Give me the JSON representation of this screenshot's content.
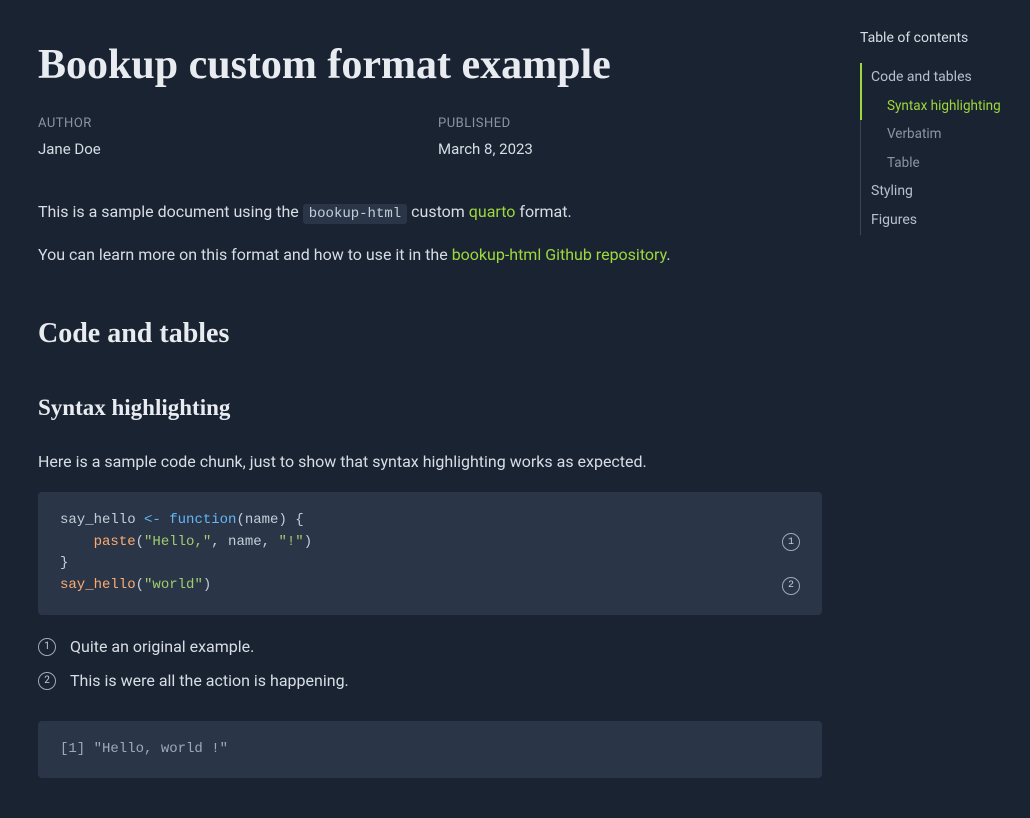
{
  "title": "Bookup custom format example",
  "meta": {
    "author_label": "AUTHOR",
    "author_value": "Jane Doe",
    "published_label": "PUBLISHED",
    "published_value": "March 8, 2023"
  },
  "intro": {
    "p1_pre": "This is a sample document using the ",
    "p1_code": "bookup-html",
    "p1_mid": " custom ",
    "p1_link": "quarto",
    "p1_post": " format.",
    "p2_pre": "You can learn more on this format and how to use it in the ",
    "p2_link": "bookup-html Github repository",
    "p2_post": "."
  },
  "sections": {
    "code_and_tables": "Code and tables",
    "syntax_highlighting": "Syntax highlighting",
    "syntax_intro": "Here is a sample code chunk, just to show that syntax highlighting works as expected."
  },
  "code": {
    "l1_name": "say_hello ",
    "l1_op": "<-",
    "l1_sp": " ",
    "l1_kw": "function",
    "l1_rest": "(name) {",
    "l2_indent": "    ",
    "l2_fn": "paste",
    "l2_p1": "(",
    "l2_s1": "\"Hello,\"",
    "l2_c1": ", name, ",
    "l2_s2": "\"!\"",
    "l2_p2": ")",
    "l3": "}",
    "l4": "",
    "l5_fn": "say_hello",
    "l5_p1": "(",
    "l5_s1": "\"world\"",
    "l5_p2": ")"
  },
  "annotations": {
    "n1": "1",
    "n2": "2",
    "t1": "Quite an original example.",
    "t2": "This is were all the action is happening."
  },
  "output": "[1] \"Hello, world !\"",
  "toc": {
    "title": "Table of contents",
    "items": [
      {
        "label": "Code and tables"
      },
      {
        "label": "Styling"
      },
      {
        "label": "Figures"
      }
    ],
    "sub": [
      {
        "label": "Syntax highlighting"
      },
      {
        "label": "Verbatim"
      },
      {
        "label": "Table"
      }
    ]
  }
}
